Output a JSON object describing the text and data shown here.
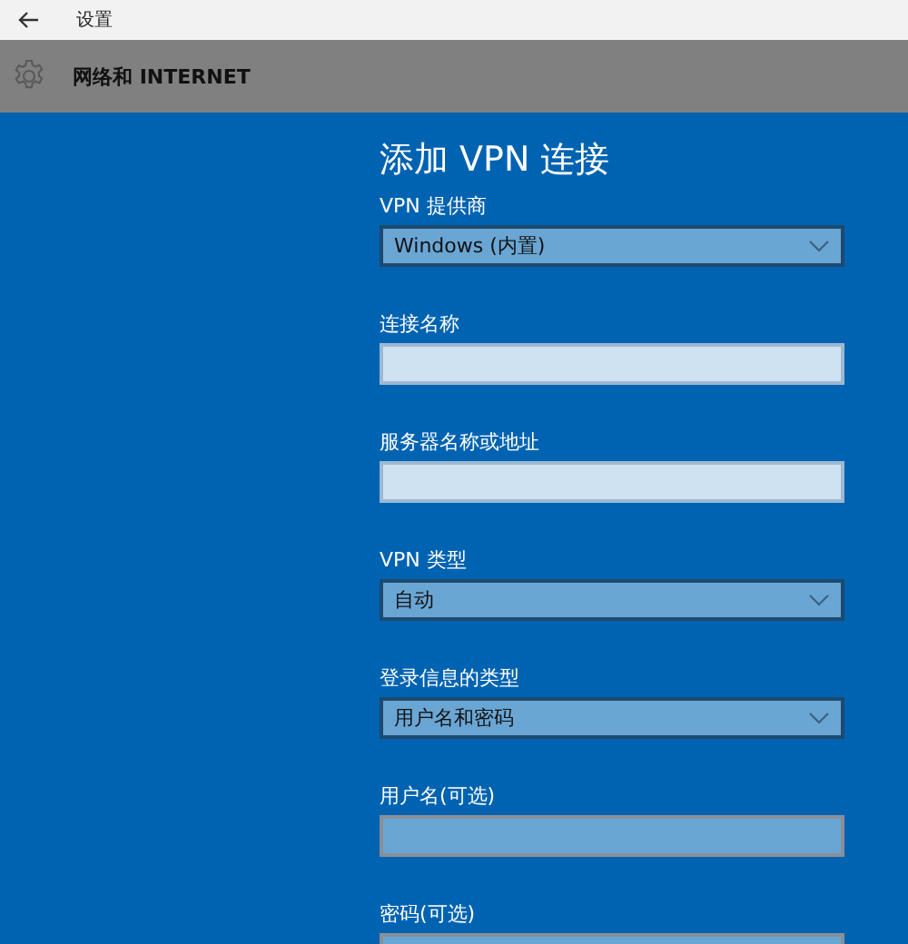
{
  "window": {
    "title": "设置"
  },
  "header": {
    "title": "网络和 INTERNET"
  },
  "form": {
    "title": "添加 VPN 连接",
    "fields": [
      {
        "label": "VPN 提供商",
        "kind": "dropdown",
        "value": "Windows (内置)",
        "disabled": false
      },
      {
        "label": "连接名称",
        "kind": "text",
        "disabled": false
      },
      {
        "label": "服务器名称或地址",
        "kind": "text",
        "disabled": false
      },
      {
        "label": "VPN 类型",
        "kind": "dropdown",
        "value": "自动",
        "disabled": false
      },
      {
        "label": "登录信息的类型",
        "kind": "dropdown",
        "value": "用户名和密码",
        "disabled": false
      },
      {
        "label": "用户名(可选)",
        "kind": "text",
        "disabled": true
      },
      {
        "label": "密码(可选)",
        "kind": "text",
        "disabled": true
      }
    ]
  }
}
